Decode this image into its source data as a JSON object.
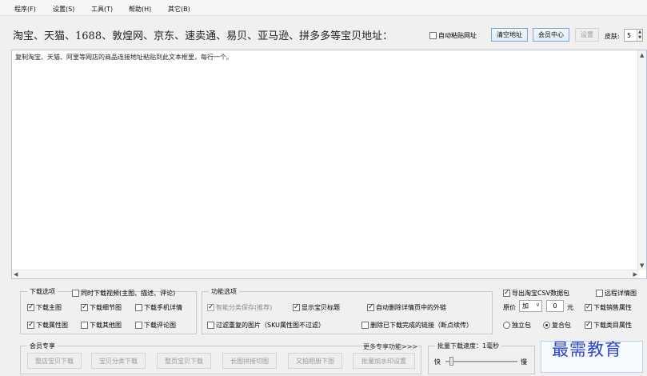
{
  "menu": [
    "程序(F)",
    "设置(S)",
    "工具(T)",
    "帮助(H)",
    "其它(B)"
  ],
  "address": {
    "label": "淘宝、天猫、1688、敦煌网、京东、速卖通、易贝、亚马逊、拼多多等宝贝地址：",
    "auto_paste": "自动粘贴网址",
    "clear_button": "清空地址",
    "member_button": "会员中心",
    "settings_button": "设置",
    "skin_label": "皮肤:",
    "skin_value": "5"
  },
  "textarea": {
    "content": "复制淘宝、天猫、阿里等网店的商品连接地址粘贴到此文本框里，每行一个。"
  },
  "download_options": {
    "title": "下载选项",
    "video": "同时下载视频(主图、描述、评论)",
    "items": [
      "下载主图",
      "下载细节图",
      "下载手机详情",
      "下载属性图",
      "下载其他图",
      "下载评论图"
    ]
  },
  "feature_options": {
    "title": "功能选项",
    "items": [
      "智能分类保存(推荐)",
      "显示宝贝标题",
      "自动删除详情页中的外链",
      "过滤重复的图片（SKU属性图不过滤）",
      "删除已下载完成的链接（断点续传）"
    ]
  },
  "right_options": {
    "export_csv": "导出淘宝CSV数据包",
    "remote_detail": "远程详情图",
    "price_label": "原价",
    "price_op": "加",
    "price_value": "0",
    "price_unit": "元",
    "sales_attr": "下载销售属性",
    "single_pkg": "独立包",
    "combined_pkg": "复合包",
    "category_attr": "下载类目属性"
  },
  "member": {
    "title": "会员专享",
    "more": "更多专享功能>>>",
    "buttons": [
      "整店宝贝下载",
      "宝贝分类下载",
      "整页宝贝下载",
      "长图拼接切图",
      "又拍相册下图",
      "批量加水印设置"
    ]
  },
  "speed": {
    "label": "批量下载速度：1毫秒",
    "fast": "快",
    "slow": "慢",
    "level": 0.05
  },
  "watermark": "最需教育"
}
